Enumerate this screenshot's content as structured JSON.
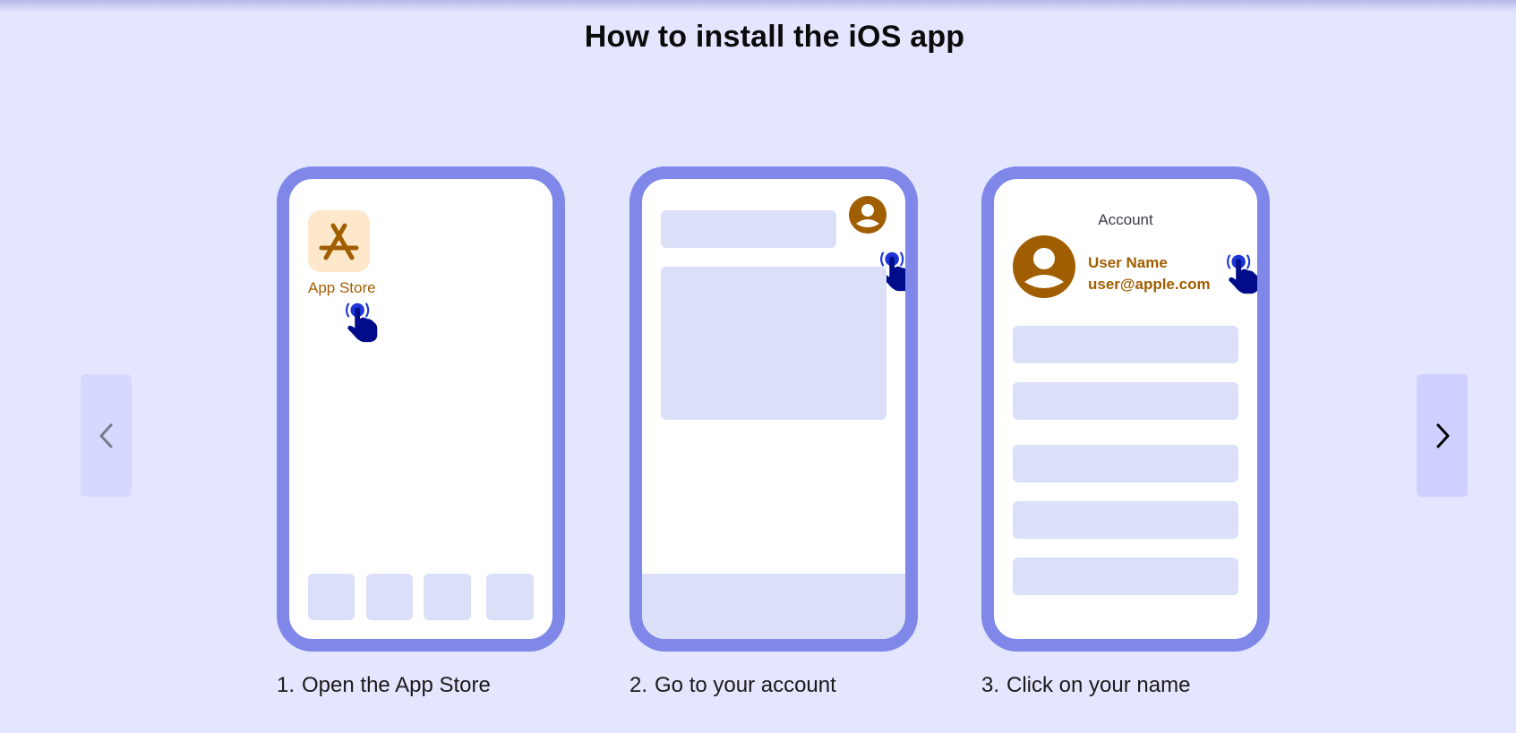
{
  "page": {
    "title": "How to install the iOS app"
  },
  "navigation": {
    "prev_label": "Previous",
    "next_label": "Next",
    "prev_icon": "chevron-left-icon",
    "next_icon": "chevron-right-icon",
    "prev_enabled": false,
    "next_enabled": true
  },
  "colors": {
    "background": "#e4e6ff",
    "phone_frame": "#7f88e8",
    "placeholder": "#dbdff8",
    "accent_brown": "#a15e00",
    "app_icon_bg": "#fde8cc",
    "hand": "#000c8a",
    "tap_dot": "#1d35d6"
  },
  "steps": [
    {
      "number": "1.",
      "caption": "Open the App Store",
      "screen": {
        "app_label": "App Store",
        "app_icon": "app-store-icon",
        "dock_items": 4
      }
    },
    {
      "number": "2.",
      "caption": "Go to your account",
      "screen": {
        "avatar_icon": "user-avatar-icon"
      }
    },
    {
      "number": "3.",
      "caption": "Click on your name",
      "screen": {
        "header": "Account",
        "user_name": "User Name",
        "user_email": "user@apple.com",
        "list_rows": 5
      }
    }
  ]
}
